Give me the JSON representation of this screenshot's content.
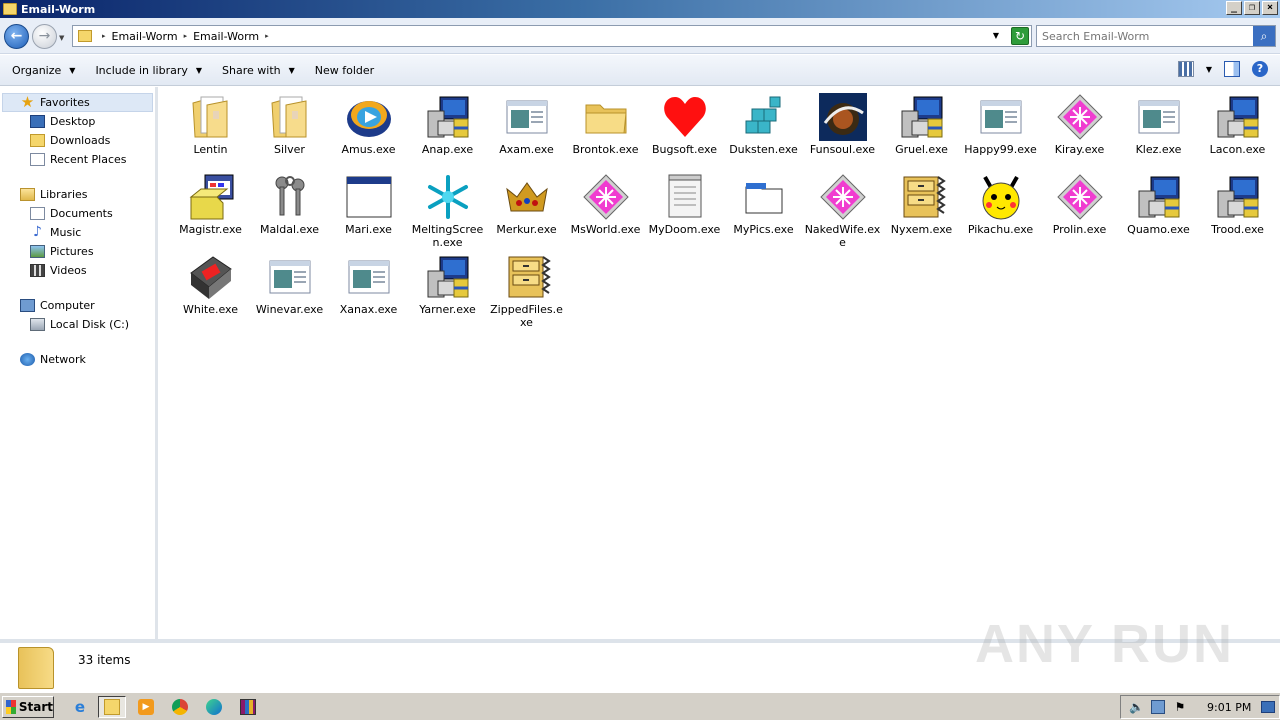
{
  "window": {
    "title": "Email-Worm"
  },
  "address": {
    "crumbs": [
      "Email-Worm",
      "Email-Worm"
    ],
    "search_placeholder": "Search Email-Worm"
  },
  "toolbar": {
    "organize": "Organize",
    "include": "Include in library",
    "share": "Share with",
    "new_folder": "New folder"
  },
  "sidebar": {
    "favorites": {
      "label": "Favorites",
      "items": [
        "Desktop",
        "Downloads",
        "Recent Places"
      ]
    },
    "libraries": {
      "label": "Libraries",
      "items": [
        "Documents",
        "Music",
        "Pictures",
        "Videos"
      ]
    },
    "computer": {
      "label": "Computer",
      "items": [
        "Local Disk (C:)"
      ]
    },
    "network": {
      "label": "Network"
    }
  },
  "files": [
    {
      "name": "Lentin",
      "icon": "folder-papers-icon"
    },
    {
      "name": "Silver",
      "icon": "folder-papers-icon"
    },
    {
      "name": "Amus.exe",
      "icon": "media-player-icon"
    },
    {
      "name": "Anap.exe",
      "icon": "setup-computer-icon"
    },
    {
      "name": "Axam.exe",
      "icon": "application-window-icon"
    },
    {
      "name": "Brontok.exe",
      "icon": "folder-icon"
    },
    {
      "name": "Bugsoft.exe",
      "icon": "heart-icon"
    },
    {
      "name": "Duksten.exe",
      "icon": "cubes-icon"
    },
    {
      "name": "Funsoul.exe",
      "icon": "funsoul-image-icon"
    },
    {
      "name": "Gruel.exe",
      "icon": "setup-computer-icon"
    },
    {
      "name": "Happy99.exe",
      "icon": "application-window-icon"
    },
    {
      "name": "Kiray.exe",
      "icon": "pink-diamond-icon"
    },
    {
      "name": "Klez.exe",
      "icon": "application-window-icon"
    },
    {
      "name": "Lacon.exe",
      "icon": "setup-computer-icon"
    },
    {
      "name": "Magistr.exe",
      "icon": "installer-box-icon"
    },
    {
      "name": "Maldal.exe",
      "icon": "keys-icon"
    },
    {
      "name": "Mari.exe",
      "icon": "blank-window-icon"
    },
    {
      "name": "MeltingScreen.exe",
      "icon": "snowflake-icon"
    },
    {
      "name": "Merkur.exe",
      "icon": "crown-icon"
    },
    {
      "name": "MsWorld.exe",
      "icon": "pink-diamond-icon"
    },
    {
      "name": "MyDoom.exe",
      "icon": "notepad-icon"
    },
    {
      "name": "MyPics.exe",
      "icon": "window-blank-icon"
    },
    {
      "name": "NakedWife.exe",
      "icon": "pink-diamond-icon"
    },
    {
      "name": "Nyxem.exe",
      "icon": "zipper-cabinet-icon"
    },
    {
      "name": "Pikachu.exe",
      "icon": "pikachu-face-icon"
    },
    {
      "name": "Prolin.exe",
      "icon": "pink-diamond-icon"
    },
    {
      "name": "Quamo.exe",
      "icon": "setup-computer-icon"
    },
    {
      "name": "Trood.exe",
      "icon": "setup-computer-icon"
    },
    {
      "name": "White.exe",
      "icon": "media-device-icon"
    },
    {
      "name": "Winevar.exe",
      "icon": "application-window-icon"
    },
    {
      "name": "Xanax.exe",
      "icon": "application-window-icon"
    },
    {
      "name": "Yarner.exe",
      "icon": "setup-computer-icon"
    },
    {
      "name": "ZippedFiles.exe",
      "icon": "zipper-cabinet-icon"
    }
  ],
  "status": {
    "count": "33 items"
  },
  "watermark": "ANY RUN",
  "taskbar": {
    "start": "Start",
    "clock": "9:01 PM"
  }
}
